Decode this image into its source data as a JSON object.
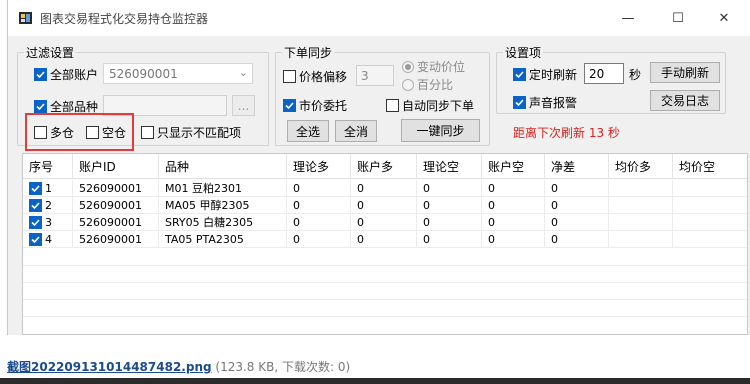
{
  "window": {
    "title": "图表交易程式化交易持仓监控器",
    "minimize_glyph": "—",
    "maximize_glyph": "☐",
    "close_glyph": "✕"
  },
  "filter": {
    "legend": "过滤设置",
    "all_accounts_label": "全部账户",
    "all_accounts_checked": true,
    "account_value": "526090001",
    "all_symbols_label": "全部品种",
    "all_symbols_checked": true,
    "symbol_value": "",
    "browse_label": "...",
    "long_label": "多仓",
    "long_checked": false,
    "short_label": "空仓",
    "short_checked": false,
    "mismatch_only_label": "只显示不匹配项",
    "mismatch_only_checked": false
  },
  "sync": {
    "legend": "下单同步",
    "price_offset_label": "价格偏移",
    "price_offset_checked": false,
    "price_offset_value": "3",
    "variable_tick_label": "变动价位",
    "variable_tick_selected": true,
    "percent_label": "百分比",
    "percent_selected": false,
    "market_order_label": "市价委托",
    "market_order_checked": true,
    "auto_sync_label": "自动同步下单",
    "auto_sync_checked": false,
    "select_all_label": "全选",
    "deselect_all_label": "全消",
    "one_click_sync_label": "一键同步"
  },
  "settings": {
    "legend": "设置项",
    "timed_refresh_label": "定时刷新",
    "timed_refresh_checked": true,
    "refresh_interval": "20",
    "seconds_unit": "秒",
    "manual_refresh_label": "手动刷新",
    "sound_alert_label": "声音报警",
    "sound_alert_checked": true,
    "trade_log_label": "交易日志",
    "countdown_text": "距离下次刷新 13 秒"
  },
  "table": {
    "columns": [
      "序号",
      "账户ID",
      "品种",
      "理论多",
      "账户多",
      "理论空",
      "账户空",
      "净差",
      "均价多",
      "均价空"
    ],
    "rows": [
      {
        "checked": true,
        "cells": [
          "1",
          "526090001",
          "M01 豆粕2301",
          "0",
          "0",
          "0",
          "0",
          "0",
          "",
          ""
        ]
      },
      {
        "checked": true,
        "cells": [
          "2",
          "526090001",
          "MA05 甲醇2305",
          "0",
          "0",
          "0",
          "0",
          "0",
          "",
          ""
        ]
      },
      {
        "checked": true,
        "cells": [
          "3",
          "526090001",
          "SRY05 白糖2305",
          "0",
          "0",
          "0",
          "0",
          "0",
          "",
          ""
        ]
      },
      {
        "checked": true,
        "cells": [
          "4",
          "526090001",
          "TA05 PTA2305",
          "0",
          "0",
          "0",
          "0",
          "0",
          "",
          ""
        ]
      }
    ]
  },
  "attachment": {
    "filename": "截图20220913101448748​2.png",
    "meta": "(123.8 KB, 下载次数: 0)"
  },
  "colors": {
    "accent": "#0a64c8",
    "highlight_box": "#e13b3b",
    "countdown": "#e02020",
    "link": "#1a4c8f"
  },
  "icons": {
    "app": "app-window-icon",
    "dropdown": "chevron-down-icon",
    "check": "checkmark-icon"
  }
}
